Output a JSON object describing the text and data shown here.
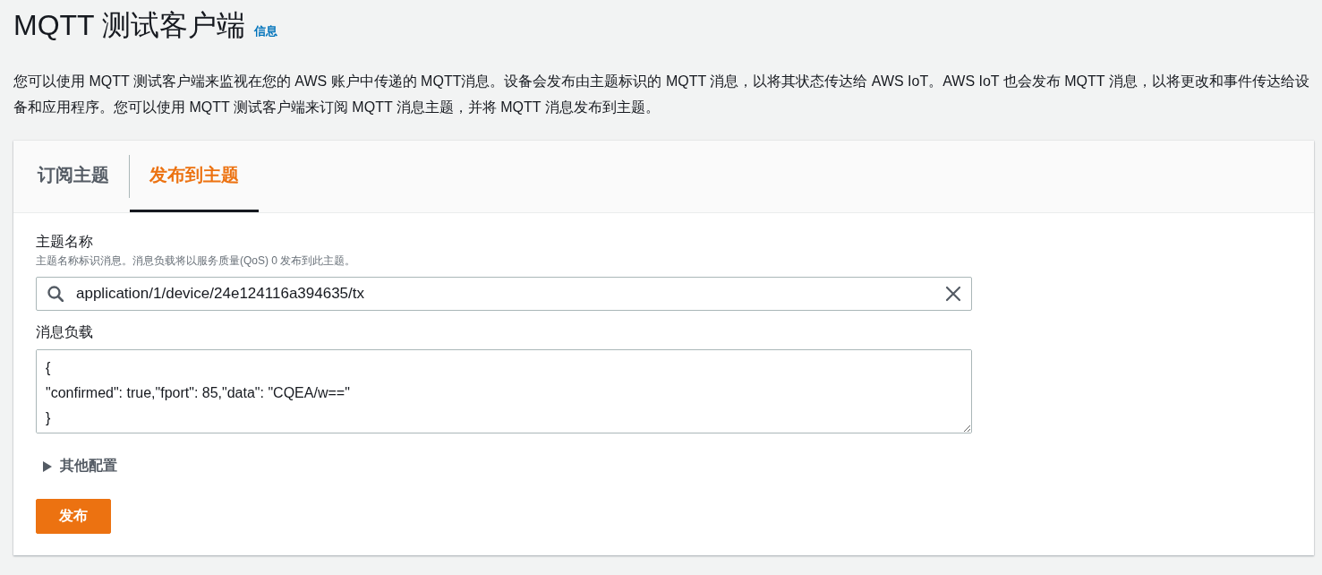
{
  "page": {
    "title": "MQTT 测试客户端",
    "info_link": "信息",
    "description": "您可以使用 MQTT 测试客户端来监视在您的 AWS 账户中传递的 MQTT消息。设备会发布由主题标识的 MQTT 消息，以将其状态传达给 AWS IoT。AWS IoT 也会发布 MQTT 消息，以将更改和事件传达给设备和应用程序。您可以使用 MQTT 测试客户端来订阅 MQTT 消息主题，并将 MQTT 消息发布到主题。"
  },
  "tabs": [
    {
      "label": "订阅主题",
      "selected": false
    },
    {
      "label": "发布到主题",
      "selected": true
    }
  ],
  "form": {
    "topic_label": "主题名称",
    "topic_hint": "主题名称标识消息。消息负载将以服务质量(QoS) 0 发布到此主题。",
    "topic_value": "application/1/device/24e124116a394635/tx",
    "payload_label": "消息负载",
    "payload_value": "{\n\"confirmed\": true,\"fport\": 85,\"data\": \"CQEA/w==\"\n}",
    "more_settings": {
      "label": "其他配置",
      "expanded": false
    },
    "publish_button": "发布"
  }
}
